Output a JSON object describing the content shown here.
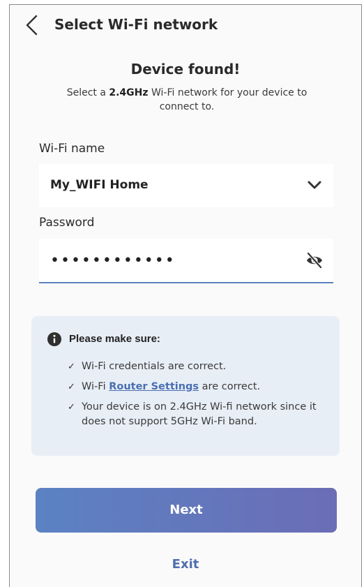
{
  "header": {
    "title": "Select Wi-Fi network",
    "back_icon": "chevron-left-icon"
  },
  "intro": {
    "heading": "Device found!",
    "sub_prefix": "Select a ",
    "sub_bold": "2.4GHz",
    "sub_suffix": " Wi-Fi network for your device to connect to."
  },
  "wifi": {
    "label": "Wi-Fi name",
    "selected": "My_WIFI Home",
    "dropdown_icon": "chevron-down-icon"
  },
  "password": {
    "label": "Password",
    "masked_value": "••••••••••••",
    "toggle_icon": "eye-off-icon"
  },
  "notice": {
    "icon": "info-icon",
    "title": "Please make sure:",
    "items": [
      {
        "text": "Wi-Fi credentials are correct."
      },
      {
        "prefix": "Wi-Fi ",
        "link": "Router Settings",
        "suffix": " are correct."
      },
      {
        "text": "Your device is on 2.4GHz Wi-fi network since it does not support 5GHz Wi-Fi band."
      }
    ],
    "check_glyph": "✓"
  },
  "actions": {
    "next_label": "Next",
    "exit_label": "Exit"
  },
  "colors": {
    "accent": "#5b82c3",
    "accent_end": "#6b6db6",
    "link": "#4a6fb2",
    "notice_bg": "#e8eef6"
  }
}
